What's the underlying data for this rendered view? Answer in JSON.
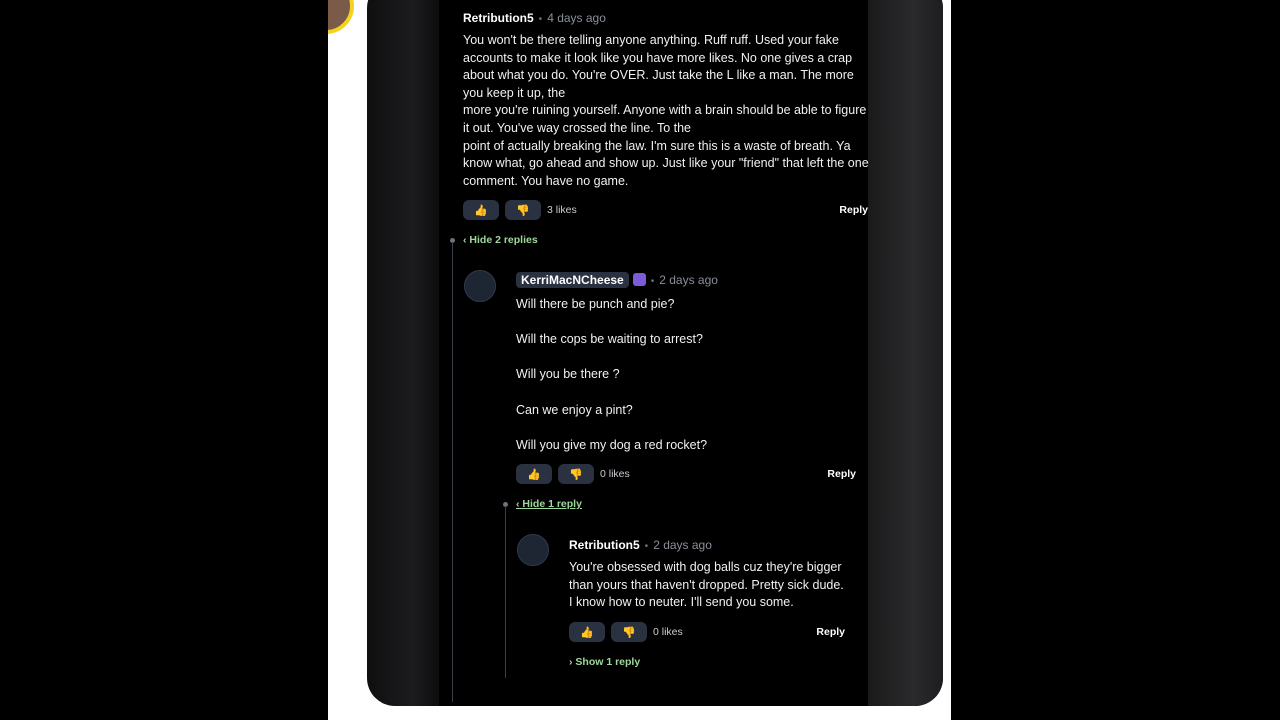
{
  "thread": {
    "comment": {
      "username": "Retribution5",
      "time": "4 days ago",
      "paragraphs": [
        "You won't be there telling anyone anything. Ruff ruff. Used your fake accounts to make it look like you have more likes. No one gives a crap about what you do. You're OVER. Just take the L like a man. The more you keep it up, the",
        "more you're ruining yourself. Anyone with a brain should be able to figure it out. You've way crossed the line. To the",
        "point of actually breaking the law. I'm sure this is a waste of breath. Ya know what, go ahead and show up. Just like your \"friend\" that left the one comment. You have no game."
      ],
      "likes": "3 likes",
      "reply_label": "Reply",
      "toggle": "‹ Hide 2 replies"
    },
    "reply1": {
      "username": "KerriMacNCheese",
      "badge_icon": "crown-icon",
      "time": "2 days ago",
      "lines": [
        "Will there be punch and pie?",
        "Will the cops be waiting to arrest?",
        "Will you be there ?",
        "Can we enjoy a pint?",
        "Will you give my dog a red rocket?"
      ],
      "likes": "0 likes",
      "reply_label": "Reply",
      "toggle": "‹ Hide 1 reply"
    },
    "reply2": {
      "username": "Retribution5",
      "time": "2 days ago",
      "lines": [
        "You're obsessed with dog balls cuz they're bigger",
        "than yours that haven't dropped. Pretty sick dude.",
        "I know how to neuter. I'll send you some."
      ],
      "likes": "0 likes",
      "reply_label": "Reply",
      "toggle": "› Show 1 reply"
    }
  }
}
